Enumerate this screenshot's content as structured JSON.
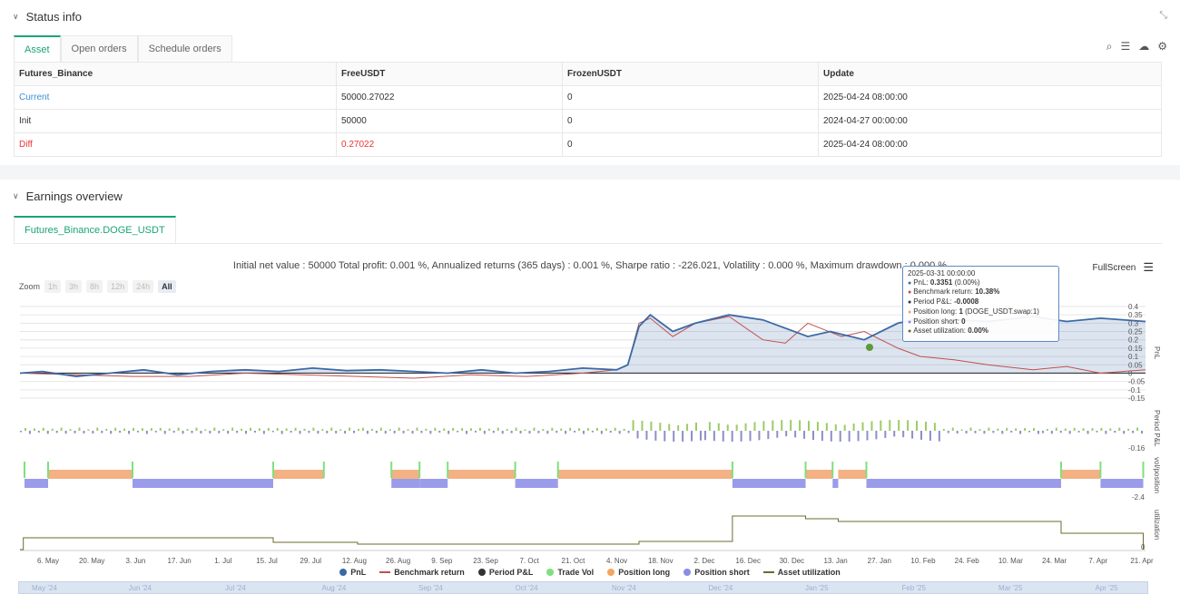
{
  "status": {
    "title": "Status info",
    "tabs": [
      "Asset",
      "Open orders",
      "Schedule orders"
    ],
    "table": {
      "headers": [
        "Futures_Binance",
        "FreeUSDT",
        "FrozenUSDT",
        "Update"
      ],
      "rows": [
        [
          "Current",
          "50000.27022",
          "0",
          "2025-04-24 08:00:00"
        ],
        [
          "Init",
          "50000",
          "0",
          "2024-04-27 00:00:00"
        ],
        [
          "Diff",
          "0.27022",
          "0",
          "2025-04-24 08:00:00"
        ]
      ]
    }
  },
  "earnings": {
    "title": "Earnings overview",
    "tab": "Futures_Binance.DOGE_USDT",
    "summary": "Initial net value : 50000 Total profit: 0.001 %, Annualized returns (365 days) : 0.001 %, Sharpe ratio : -226.021, Volatility : 0.000 %, Maximum drawdown : 0.000 %",
    "fullscreen": "FullScreen",
    "zoom": {
      "label": "Zoom",
      "buttons": [
        "1h",
        "3h",
        "8h",
        "12h",
        "24h",
        "All"
      ],
      "active": "All"
    },
    "tooltip": {
      "date": "2025-03-31 00:00:00",
      "lines": [
        {
          "label": "PnL: ",
          "value": "0.3351",
          "suffix": " (0.00%)",
          "color": "#3b6aa6"
        },
        {
          "label": "Benchmark return: ",
          "value": "10.38%",
          "suffix": "",
          "color": "#c0504d"
        },
        {
          "label": "Period P&L: ",
          "value": "-0.0008",
          "suffix": "",
          "color": "#333333"
        },
        {
          "label": "Position long: ",
          "value": "1",
          "suffix": " (DOGE_USDT.swap:1)",
          "color": "#f4a460"
        },
        {
          "label": "Position short: ",
          "value": "0",
          "suffix": "",
          "color": "#8a8ce6"
        },
        {
          "label": "Asset utilization: ",
          "value": "0.00%",
          "suffix": "",
          "color": "#6b6b2e"
        }
      ]
    },
    "legend": [
      {
        "name": "PnL",
        "color": "#3b6aa6",
        "kind": "dot"
      },
      {
        "name": "Benchmark return",
        "color": "#c0504d",
        "kind": "line"
      },
      {
        "name": "Period P&L",
        "color": "#333333",
        "kind": "dot"
      },
      {
        "name": "Trade Vol",
        "color": "#7ee07e",
        "kind": "dot"
      },
      {
        "name": "Position long",
        "color": "#f4a460",
        "kind": "dot"
      },
      {
        "name": "Position short",
        "color": "#8a8ce6",
        "kind": "dot"
      },
      {
        "name": "Asset utilization",
        "color": "#6b6b2e",
        "kind": "line"
      }
    ],
    "navigator_labels": [
      "May '24",
      "Jun '24",
      "Jul '24",
      "Aug '24",
      "Sep '24",
      "Oct '24",
      "Nov '24",
      "Dec '24",
      "Jan '25",
      "Feb '25",
      "Mar '25",
      "Apr '25"
    ]
  },
  "chart_data": {
    "type": "line",
    "x_ticks": [
      "6. May",
      "20. May",
      "3. Jun",
      "17. Jun",
      "1. Jul",
      "15. Jul",
      "29. Jul",
      "12. Aug",
      "26. Aug",
      "9. Sep",
      "23. Sep",
      "7. Oct",
      "21. Oct",
      "4. Nov",
      "18. Nov",
      "2. Dec",
      "16. Dec",
      "30. Dec",
      "13. Jan",
      "27. Jan",
      "10. Feb",
      "24. Feb",
      "10. Mar",
      "24. Mar",
      "7. Apr",
      "21. Apr"
    ],
    "pnl_axis": {
      "ylabel": "PnL",
      "ticks": [
        0.4,
        0.35,
        0.3,
        0.25,
        0.2,
        0.15,
        0.1,
        0.05,
        0,
        -0.05,
        -0.1,
        -0.15
      ],
      "ylim": [
        -0.15,
        0.4
      ]
    },
    "period_axis": {
      "ylabel": "Period P&L",
      "ticks": [
        -0.16
      ]
    },
    "vol_axis": {
      "ylabel": "vol/position",
      "ticks": [
        -2.4
      ]
    },
    "util_axis": {
      "ylabel": "utilization",
      "ticks": [
        0
      ]
    },
    "series": [
      {
        "name": "PnL",
        "x_frac": [
          0,
          0.02,
          0.05,
          0.08,
          0.11,
          0.14,
          0.17,
          0.2,
          0.23,
          0.26,
          0.29,
          0.32,
          0.35,
          0.38,
          0.41,
          0.44,
          0.47,
          0.5,
          0.53,
          0.54,
          0.55,
          0.56,
          0.58,
          0.6,
          0.63,
          0.66,
          0.7,
          0.72,
          0.75,
          0.78,
          0.8,
          0.83,
          0.86,
          0.9,
          0.93,
          0.96,
          1.0
        ],
        "values": [
          0.0,
          0.01,
          -0.02,
          0.0,
          0.02,
          -0.01,
          0.01,
          0.02,
          0.01,
          0.03,
          0.015,
          0.02,
          0.01,
          0.0,
          0.02,
          0.0,
          0.01,
          0.03,
          0.02,
          0.05,
          0.28,
          0.35,
          0.25,
          0.3,
          0.35,
          0.32,
          0.22,
          0.25,
          0.2,
          0.3,
          0.33,
          0.32,
          0.31,
          0.34,
          0.31,
          0.33,
          0.31
        ]
      },
      {
        "name": "Benchmark return",
        "x_frac": [
          0,
          0.05,
          0.1,
          0.15,
          0.2,
          0.25,
          0.3,
          0.35,
          0.4,
          0.45,
          0.5,
          0.53,
          0.54,
          0.55,
          0.56,
          0.58,
          0.6,
          0.63,
          0.66,
          0.68,
          0.7,
          0.73,
          0.75,
          0.78,
          0.8,
          0.83,
          0.86,
          0.9,
          0.93,
          0.96,
          1.0
        ],
        "values": [
          0.0,
          -0.01,
          -0.02,
          -0.02,
          0.0,
          -0.01,
          -0.02,
          -0.03,
          -0.01,
          -0.02,
          0.0,
          0.02,
          0.05,
          0.3,
          0.33,
          0.22,
          0.3,
          0.34,
          0.2,
          0.18,
          0.3,
          0.22,
          0.25,
          0.15,
          0.1,
          0.08,
          0.05,
          0.02,
          0.04,
          0.0,
          0.02
        ]
      }
    ]
  }
}
